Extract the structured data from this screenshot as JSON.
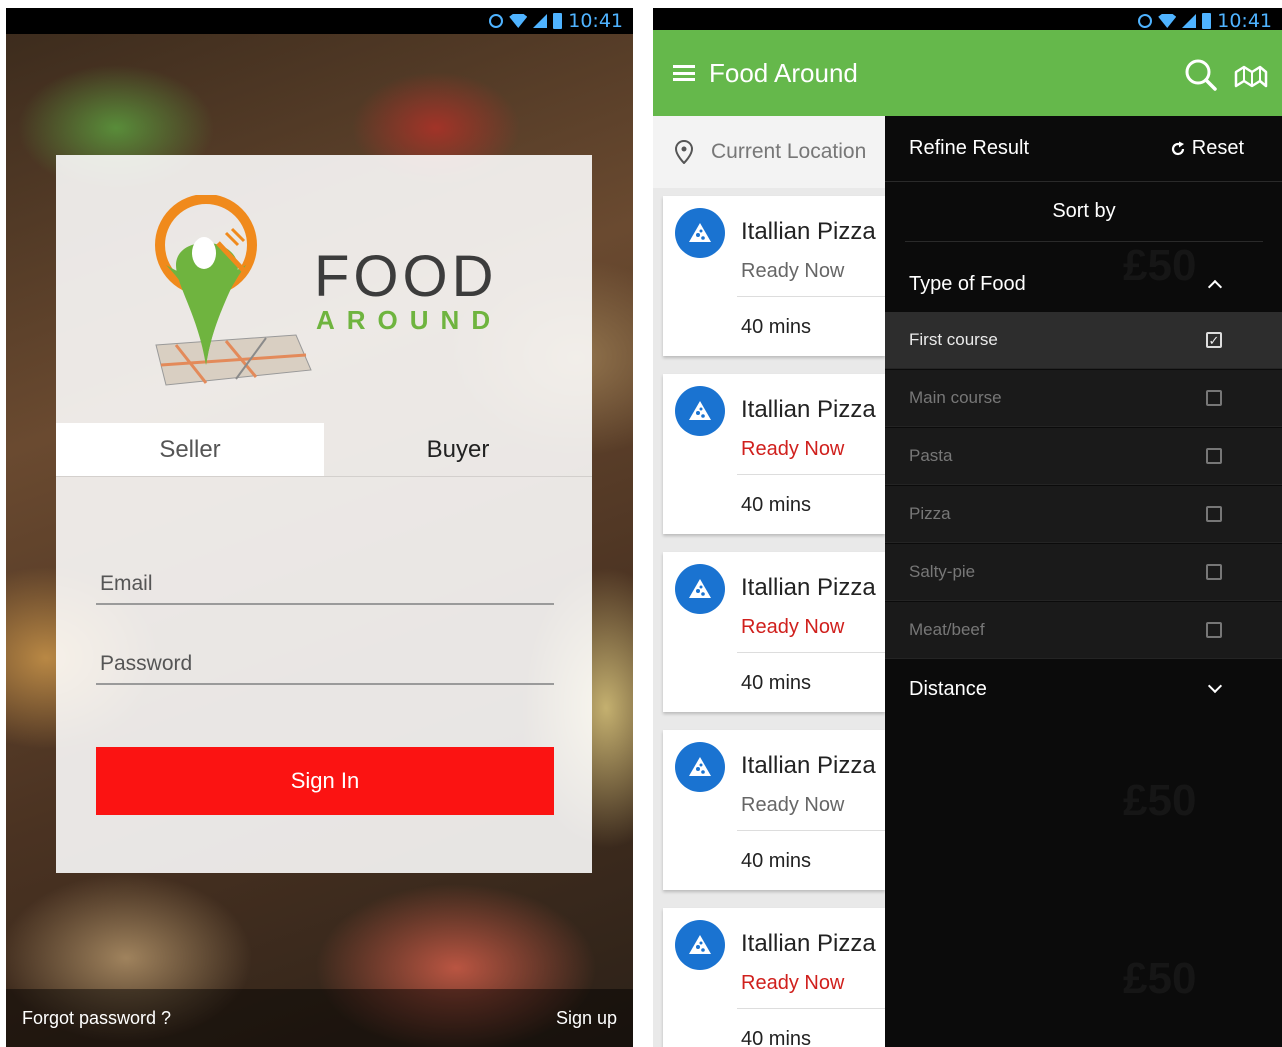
{
  "left": {
    "status": {
      "time": "10:41"
    },
    "logo": {
      "word1": "FOOD",
      "word2": "AROUND"
    },
    "tabs": [
      {
        "label": "Seller"
      },
      {
        "label": "Buyer"
      }
    ],
    "email": {
      "placeholder": "Email"
    },
    "password": {
      "placeholder": "Password"
    },
    "signin_label": "Sign In",
    "footer": {
      "forgot": "Forgot password ?",
      "signup": "Sign up"
    }
  },
  "right": {
    "status": {
      "time": "10:41"
    },
    "app_title": "Food Around",
    "location": "Current Location",
    "cards": [
      {
        "name": "Itallian Pizza",
        "status": "Ready Now",
        "time": "40 mins",
        "status_color": "#666666"
      },
      {
        "name": "Itallian Pizza",
        "status": "Ready Now",
        "time": "40 mins",
        "status_color": "#d0201d"
      },
      {
        "name": "Itallian Pizza",
        "status": "Ready Now",
        "time": "40 mins",
        "status_color": "#d0201d"
      },
      {
        "name": "Itallian Pizza",
        "status": "Ready Now",
        "time": "40 mins",
        "status_color": "#666666"
      },
      {
        "name": "Itallian Pizza",
        "status": "Ready Now",
        "time": "40 mins",
        "status_color": "#d0201d"
      }
    ],
    "filter": {
      "title": "Refine Result",
      "reset": "Reset",
      "sort_by": "Sort by",
      "type_of_food": "Type of Food",
      "options": [
        {
          "label": "First course",
          "checked": true
        },
        {
          "label": "Main course",
          "checked": false
        },
        {
          "label": "Pasta",
          "checked": false
        },
        {
          "label": "Pizza",
          "checked": false
        },
        {
          "label": "Salty-pie",
          "checked": false
        },
        {
          "label": "Meat/beef",
          "checked": false
        }
      ],
      "distance": "Distance"
    },
    "ghost_price": "£50"
  },
  "colors": {
    "accent_green": "#65b84b",
    "signin_red": "#fb1312",
    "ready_red": "#d0201d",
    "avatar_blue": "#1a73d1"
  }
}
